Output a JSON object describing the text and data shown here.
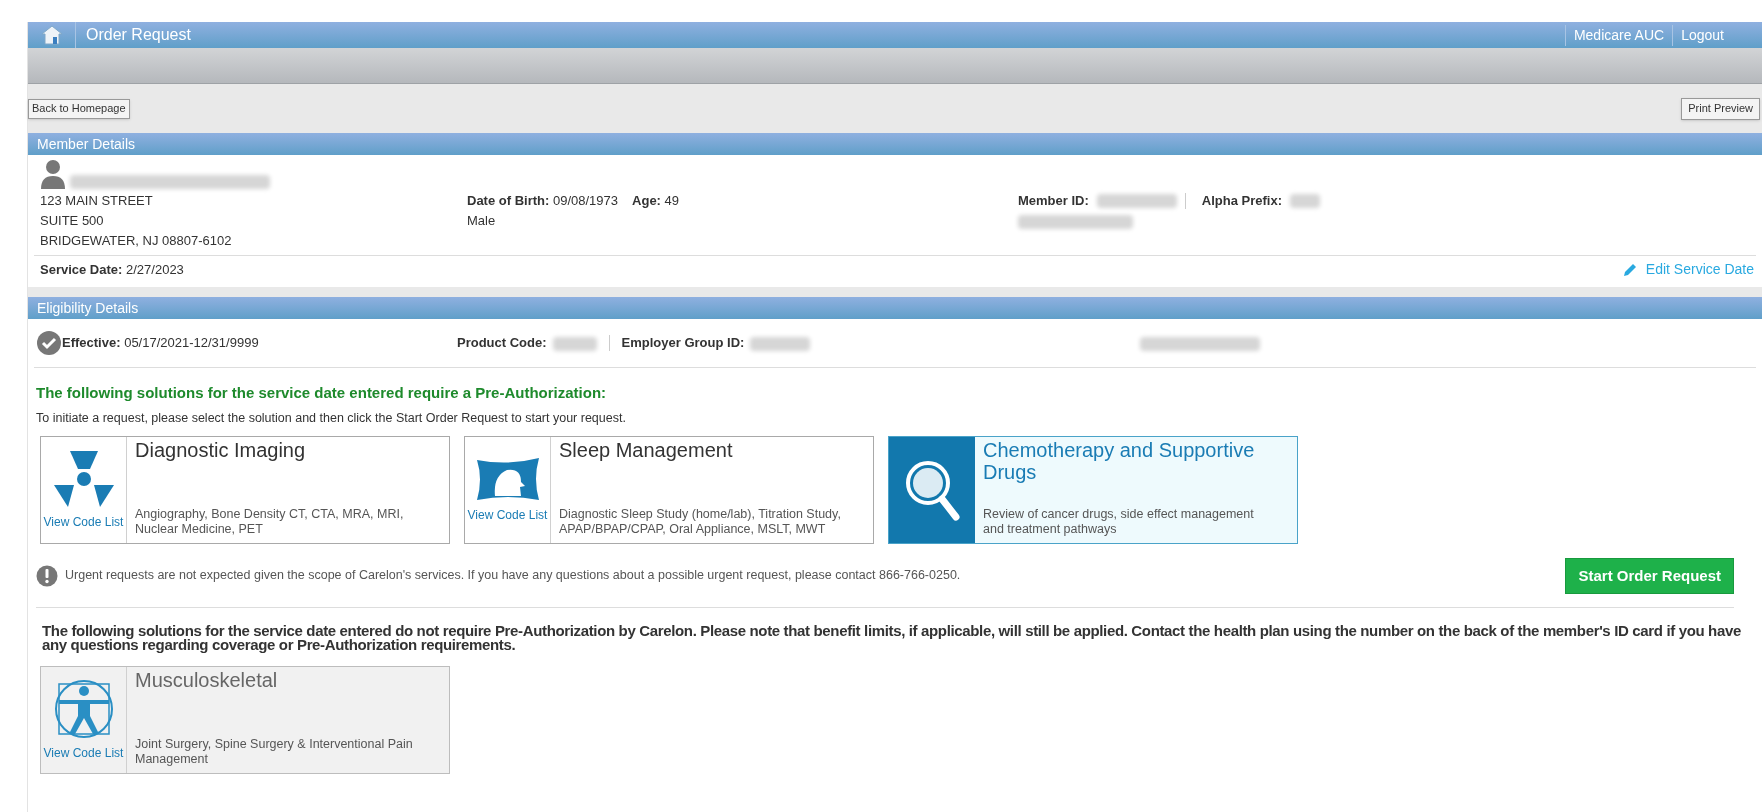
{
  "header": {
    "title": "Order Request",
    "links": [
      "Medicare AUC",
      "Logout"
    ]
  },
  "toolbar": {
    "back_button": "Back to Homepage",
    "print_button": "Print Preview"
  },
  "member_details": {
    "title": "Member Details",
    "address": [
      "123 MAIN STREET",
      "SUITE 500",
      "BRIDGEWATER, NJ 08807-6102"
    ],
    "dob_label": "Date of Birth:",
    "dob": "09/08/1973",
    "age_label": "Age:",
    "age": "49",
    "gender": "Male",
    "member_id_label": "Member ID:",
    "alpha_prefix_label": "Alpha Prefix:",
    "service_date_label": "Service Date:",
    "service_date": "2/27/2023",
    "edit_link": "Edit Service Date"
  },
  "eligibility": {
    "title": "Eligibility Details",
    "effective_label": "Effective:",
    "effective": "05/17/2021-12/31/9999",
    "product_code_label": "Product Code:",
    "employer_group_label": "Employer Group ID:"
  },
  "preauth": {
    "heading": "The following solutions for the service date entered require a Pre-Authorization:",
    "instruction": "To initiate a request, please select the solution and then click the Start Order Request to start your request.",
    "solutions": [
      {
        "kind": "imaging",
        "title": "Diagnostic Imaging",
        "description": "Angiography, Bone Density CT, CTA, MRA, MRI, Nuclear Medicine, PET",
        "code_link": "View Code List",
        "selected": false
      },
      {
        "kind": "sleep",
        "title": "Sleep Management",
        "description": "Diagnostic Sleep Study (home/lab), Titration Study, APAP/BPAP/CPAP, Oral Appliance, MSLT, MWT",
        "code_link": "View Code List",
        "selected": false
      },
      {
        "kind": "drugs",
        "title": "Chemotherapy and Supportive Drugs",
        "description": "Review of cancer drugs, side effect management and treatment pathways",
        "selected": true
      }
    ],
    "urgent_note": "Urgent requests are not expected given the scope of Carelon's services. If you have any questions about a possible urgent request, please contact 866-766-0250.",
    "start_button": "Start Order Request"
  },
  "no_preauth": {
    "heading": "The following solutions for the service date entered do not require Pre-Authorization by Carelon. Please note that benefit limits, if applicable, will still be applied. Contact the health plan using the number on the back of the member's ID card if you have any questions regarding coverage or Pre-Authorization requirements.",
    "solutions": [
      {
        "kind": "musculoskeletal",
        "title": "Musculoskeletal",
        "description": "Joint Surgery, Spine Surgery & Interventional Pain Management",
        "code_link": "View Code List"
      }
    ]
  }
}
